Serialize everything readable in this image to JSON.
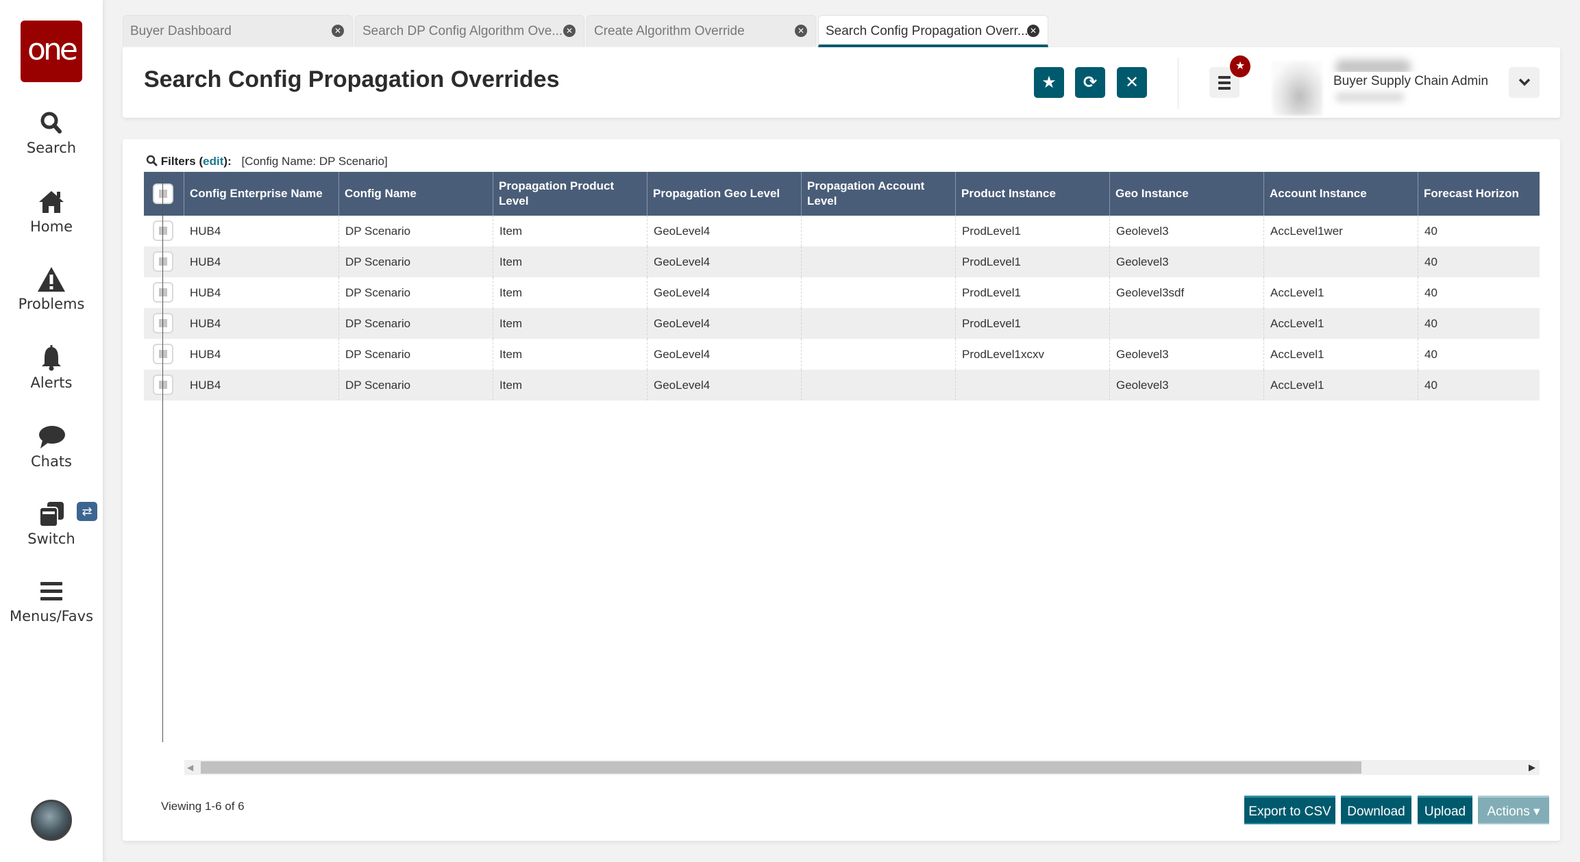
{
  "brand": {
    "logo_text": "one",
    "color": "#990000"
  },
  "sidebar": {
    "items": [
      {
        "label": "Search",
        "icon": "search-icon"
      },
      {
        "label": "Home",
        "icon": "home-icon"
      },
      {
        "label": "Problems",
        "icon": "warning-icon"
      },
      {
        "label": "Alerts",
        "icon": "bell-icon"
      },
      {
        "label": "Chats",
        "icon": "chat-icon"
      },
      {
        "label": "Switch",
        "icon": "switch-windows-icon"
      },
      {
        "label": "Menus/Favs",
        "icon": "hamburger-icon"
      }
    ],
    "switch_badge": "⇄"
  },
  "tabs": [
    {
      "label": "Buyer Dashboard",
      "active": false
    },
    {
      "label": "Search DP Config Algorithm Ove...",
      "active": false
    },
    {
      "label": "Create Algorithm Override",
      "active": false
    },
    {
      "label": "Search Config Propagation Overr...",
      "active": true
    }
  ],
  "header": {
    "title": "Search Config Propagation Overrides",
    "buttons": {
      "favorite": "★",
      "refresh": "⟳",
      "close": "✕"
    },
    "user": {
      "role": "Buyer Supply Chain Admin"
    },
    "notification_badge": "★",
    "chevron": "⌄"
  },
  "filters": {
    "label": "Filters",
    "edit_label": "edit",
    "value": "[Config Name: DP Scenario]"
  },
  "table": {
    "columns": [
      "Config Enterprise Name",
      "Config Name",
      "Propagation Product Level",
      "Propagation Geo Level",
      "Propagation Account Level",
      "Product Instance",
      "Geo Instance",
      "Account Instance",
      "Forecast Horizon"
    ],
    "rows": [
      [
        "HUB4",
        "DP Scenario",
        "Item",
        "GeoLevel4",
        "",
        "ProdLevel1",
        "Geolevel3",
        "AccLevel1wer",
        "40"
      ],
      [
        "HUB4",
        "DP Scenario",
        "Item",
        "GeoLevel4",
        "",
        "ProdLevel1",
        "Geolevel3",
        "",
        "40"
      ],
      [
        "HUB4",
        "DP Scenario",
        "Item",
        "GeoLevel4",
        "",
        "ProdLevel1",
        "Geolevel3sdf",
        "AccLevel1",
        "40"
      ],
      [
        "HUB4",
        "DP Scenario",
        "Item",
        "GeoLevel4",
        "",
        "ProdLevel1",
        "",
        "AccLevel1",
        "40"
      ],
      [
        "HUB4",
        "DP Scenario",
        "Item",
        "GeoLevel4",
        "",
        "ProdLevel1xcxv",
        "Geolevel3",
        "AccLevel1",
        "40"
      ],
      [
        "HUB4",
        "DP Scenario",
        "Item",
        "GeoLevel4",
        "",
        "",
        "Geolevel3",
        "AccLevel1",
        "40"
      ]
    ]
  },
  "footer": {
    "viewing": "Viewing 1-6 of 6",
    "buttons": {
      "export_csv": "Export to CSV",
      "download": "Download",
      "upload": "Upload",
      "actions": "Actions ▾"
    }
  },
  "colors": {
    "accent": "#005a6e",
    "table_header": "#4a5d78",
    "badge": "#990000"
  }
}
